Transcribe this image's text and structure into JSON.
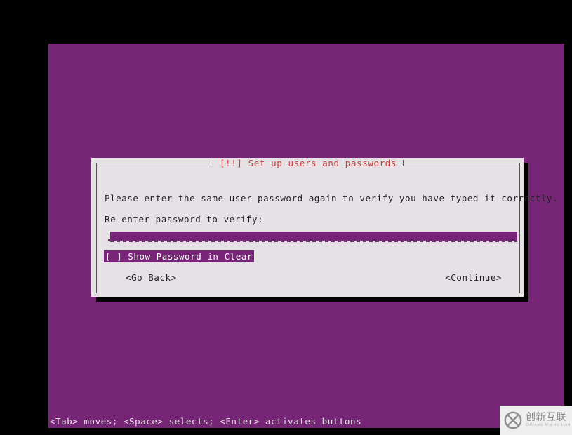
{
  "screen": {
    "background_color": "#000000",
    "desktop_color": "#772677"
  },
  "dialog": {
    "title": "[!!] Set up users and passwords",
    "title_color": "#cc3a3a",
    "background_color": "#e5e1e5",
    "border_color": "#555055",
    "prompt_main": "Please enter the same user password again to verify you have typed it correctly.",
    "prompt_reenter": "Re-enter password to verify:",
    "password_input": {
      "value": "",
      "placeholder": "",
      "accent_color": "#772677"
    },
    "show_password": {
      "label": "[ ] Show Password in Clear",
      "checked": false,
      "highlight_color": "#772677",
      "text_color": "#ffffff"
    },
    "buttons": {
      "go_back": "<Go Back>",
      "continue": "<Continue>"
    }
  },
  "status_bar": {
    "text": "<Tab> moves; <Space> selects; <Enter> activates buttons",
    "background_color": "#772677",
    "text_color": "#e8e4e8"
  },
  "watermark": {
    "icon": "circled-x-icon",
    "chinese": "创新互联",
    "pinyin": "CHUANG XIN HU LIAN",
    "background_color": "#efefef"
  }
}
